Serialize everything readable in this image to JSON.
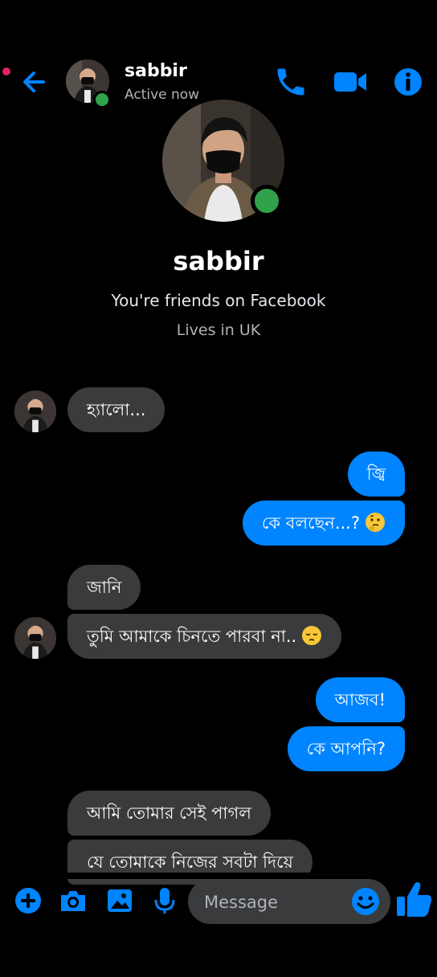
{
  "header": {
    "name": "sabbir",
    "status": "Active now"
  },
  "profile": {
    "name": "sabbir",
    "friends_text": "You're friends on Facebook",
    "lives_text": "Lives in UK"
  },
  "messages": [
    {
      "direction": "incoming",
      "text": "হ্যালো..."
    },
    {
      "direction": "outgoing",
      "text": "জ্বি"
    },
    {
      "direction": "outgoing",
      "text": "কে বলছেন...?",
      "emoji": "thinking-face"
    },
    {
      "direction": "incoming",
      "text": "জানি"
    },
    {
      "direction": "incoming",
      "text": "তুমি আমাকে চিনতে পারবা না..",
      "emoji": "pensive-face"
    },
    {
      "direction": "outgoing",
      "text": "আজব!"
    },
    {
      "direction": "outgoing",
      "text": "কে আপনি?"
    },
    {
      "direction": "incoming",
      "text": "আমি তোমার সেই পাগল"
    },
    {
      "direction": "incoming",
      "text": "যে তোমাকে নিজের সবটা দিয়ে"
    }
  ],
  "composer": {
    "placeholder": "Message"
  },
  "colors": {
    "accent": "#0084ff",
    "incoming_bubble": "#3a3b3c",
    "online": "#31a24c",
    "background": "#000000"
  }
}
